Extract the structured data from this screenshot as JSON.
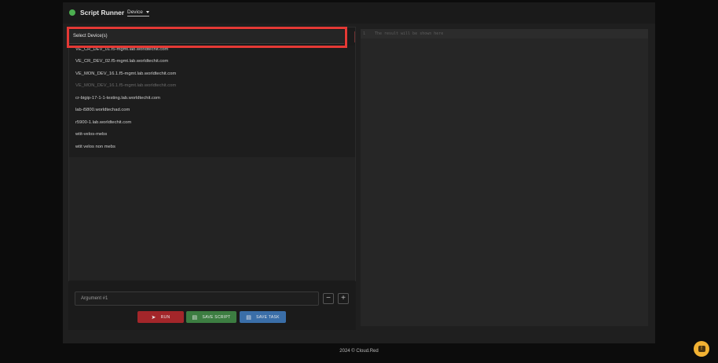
{
  "header": {
    "title": "Script Runner",
    "device_dropdown": "Device"
  },
  "device_select": {
    "placeholder": "Select Device(s)",
    "options": [
      {
        "label": "VE_CR_DEV_01.f5-mgmt.lab.worldtechit.com",
        "disabled": false
      },
      {
        "label": "VE_CR_DEV_02.f5-mgmt.lab.worldtechit.com",
        "disabled": false
      },
      {
        "label": "VE_MON_DEV_16.1.f5-mgmt.lab.worldtechit.com",
        "disabled": false
      },
      {
        "label": "VE_MON_DEV_16.1.f5-mgmt.lab.worldtechit.com",
        "disabled": true
      },
      {
        "label": "cr-bigip-17-1-1-testing.lab.worldtechit.com",
        "disabled": false
      },
      {
        "label": "lab-i5800.worldtechad.com",
        "disabled": false
      },
      {
        "label": "r5900-1.lab.worldtechit.com",
        "disabled": false
      },
      {
        "label": "wtit-velos-mebs",
        "disabled": false
      },
      {
        "label": "wtit velos non mebs",
        "disabled": false
      }
    ]
  },
  "arguments": {
    "placeholder": "Argument #1"
  },
  "actions": {
    "run": "RUN",
    "save_script": "SAVE SCRIPT",
    "save_task": "SAVE TASK"
  },
  "result": {
    "line_number": "1",
    "placeholder": "The result will be shown here"
  },
  "footer": {
    "text": "2024 © Cloud.Red"
  },
  "colors": {
    "status": "#4caf50",
    "run": "#a3262a",
    "save_script": "#3c7d41",
    "save_task": "#3a6ea8",
    "highlight": "#e53935",
    "help": "#f2b233"
  }
}
